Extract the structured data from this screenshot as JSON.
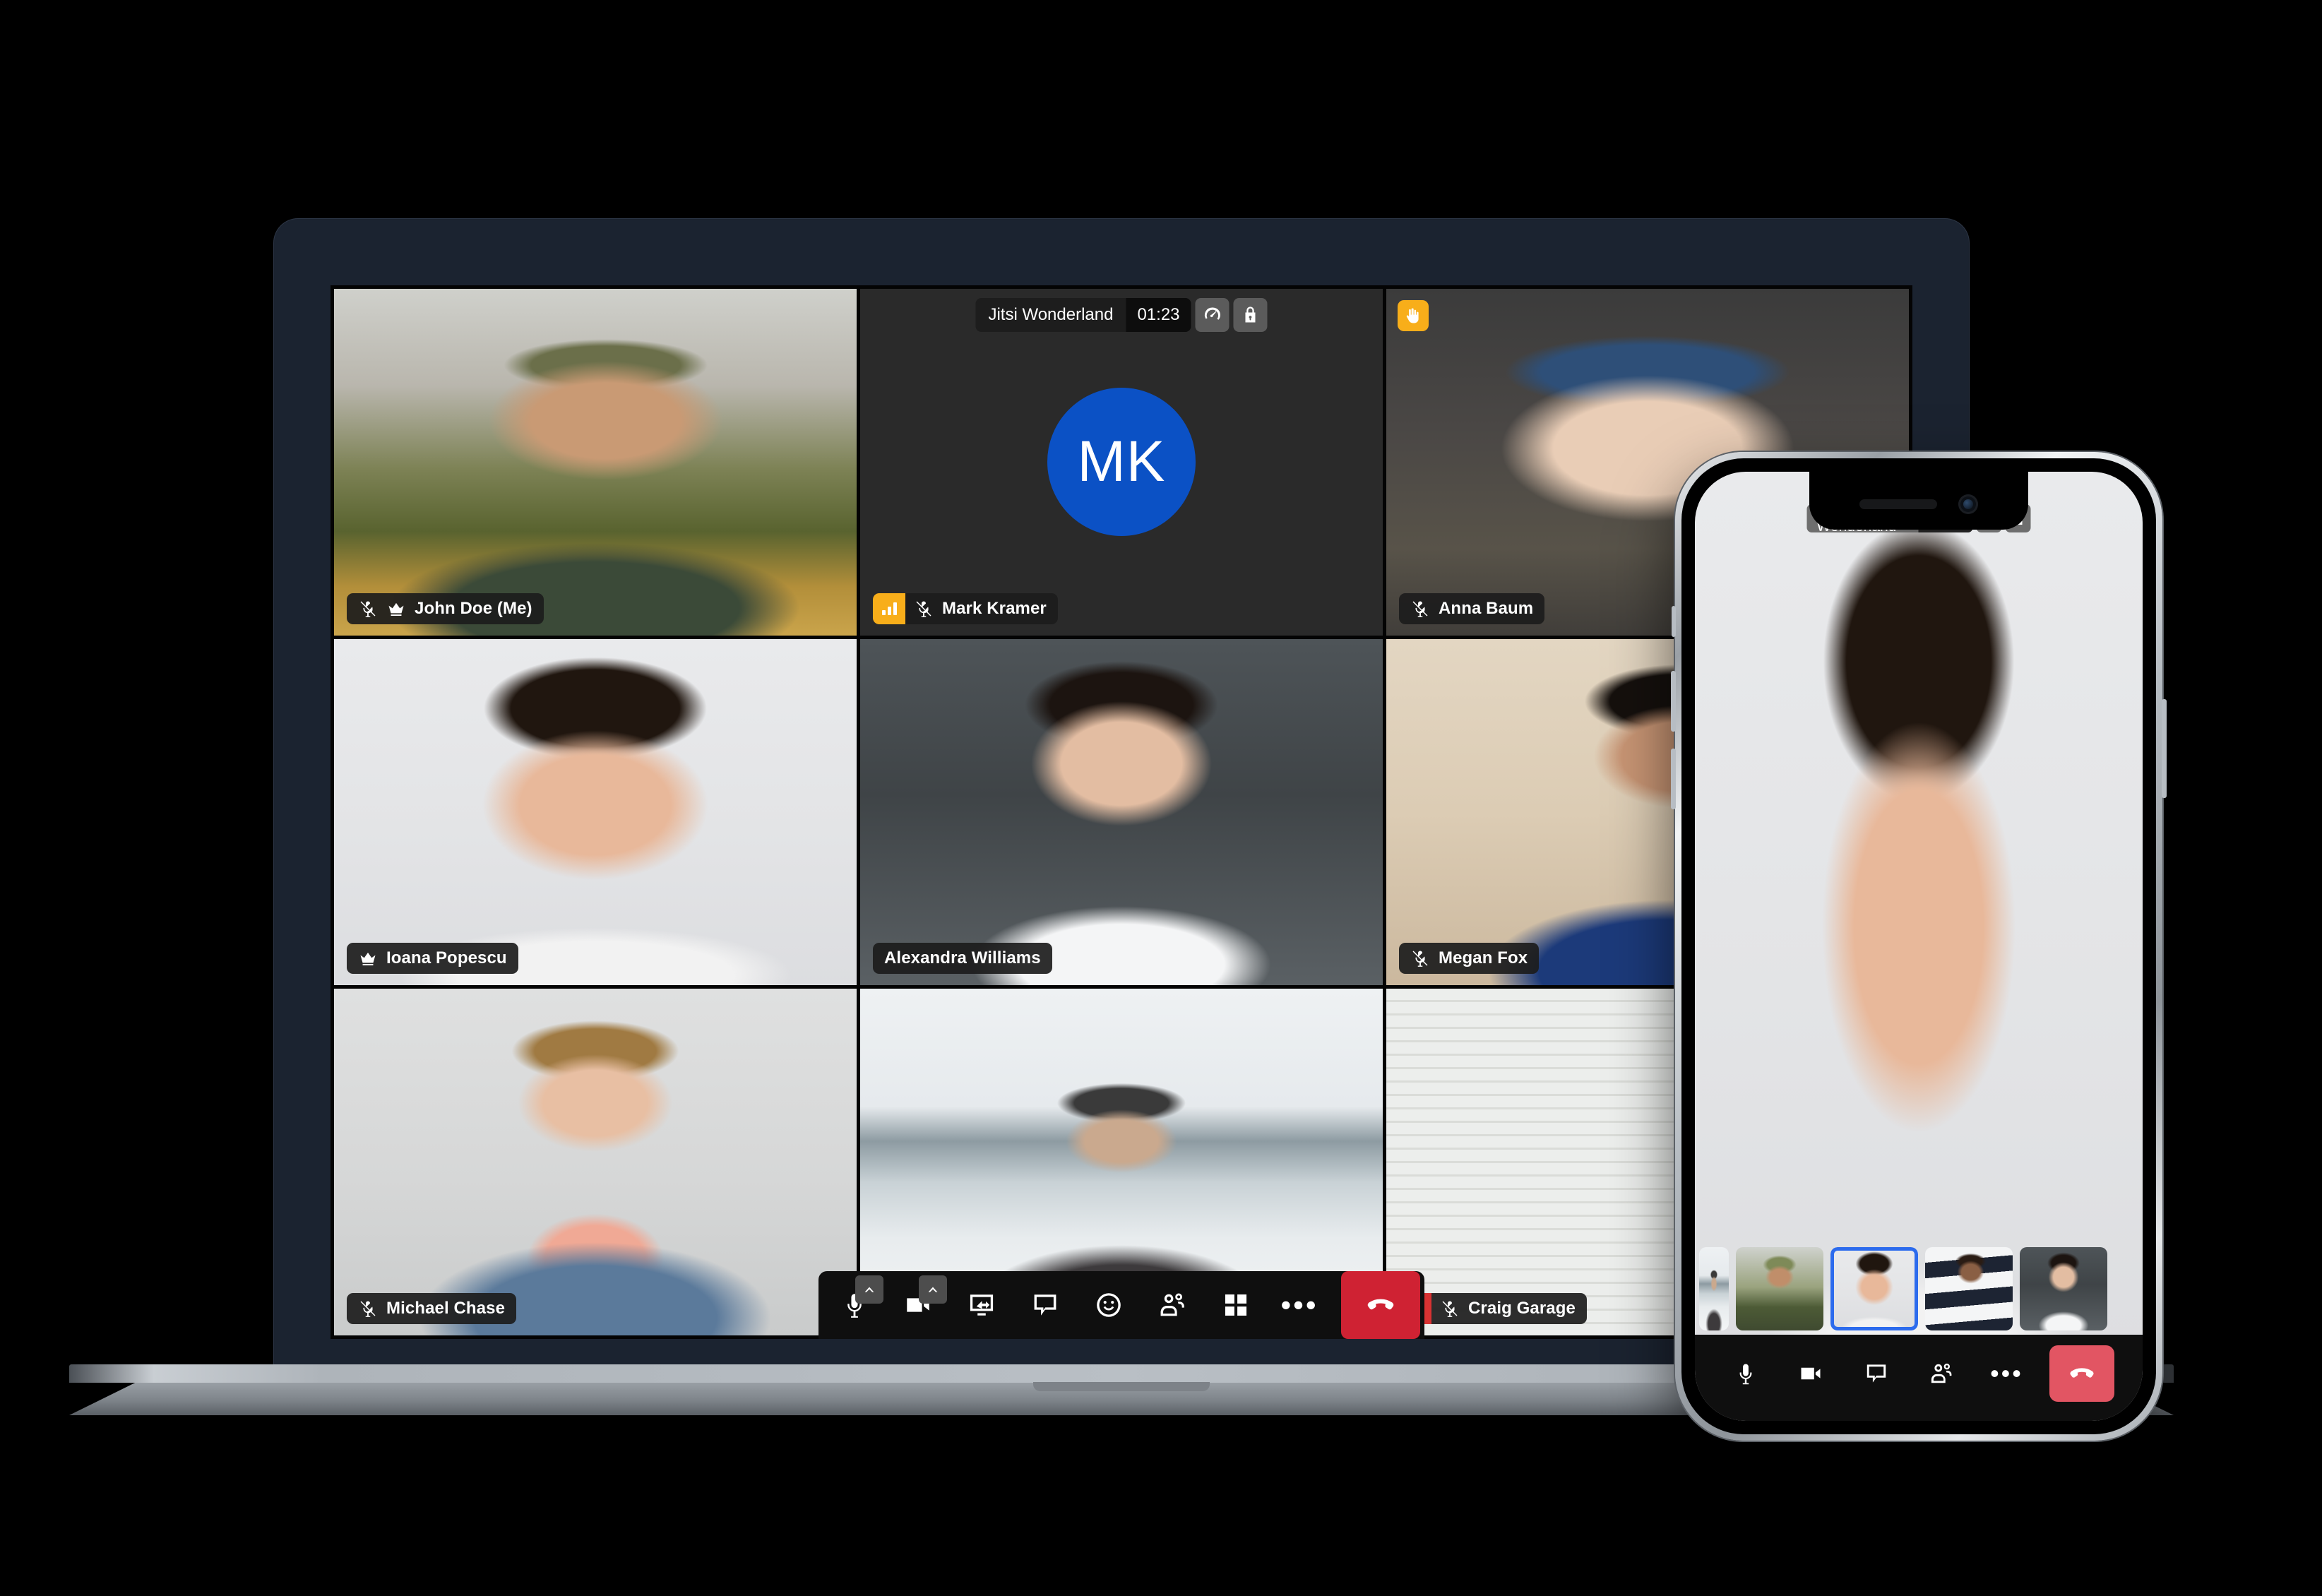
{
  "conference": {
    "name": "Jitsi Wonderland",
    "duration": "01:23",
    "quality_icon": "speedometer-icon",
    "security_icon": "lock-icon"
  },
  "laptop": {
    "tiles": [
      {
        "name": "John Doe (Me)",
        "photo": "p-john",
        "muted": true,
        "moderator": true,
        "connection": null,
        "hand": false,
        "active": false,
        "avatar": null
      },
      {
        "name": "Mark Kramer",
        "photo": null,
        "muted": true,
        "moderator": false,
        "connection": "good",
        "hand": false,
        "active": false,
        "avatar": "MK"
      },
      {
        "name": "Anna Baum",
        "photo": "p-anna",
        "muted": true,
        "moderator": false,
        "connection": null,
        "hand": true,
        "active": false,
        "avatar": null
      },
      {
        "name": "Ioana Popescu",
        "photo": "p-ioana",
        "muted": false,
        "moderator": true,
        "connection": null,
        "hand": false,
        "active": true,
        "avatar": null
      },
      {
        "name": "Alexandra Williams",
        "photo": "p-alex",
        "muted": false,
        "moderator": false,
        "connection": null,
        "hand": false,
        "active": false,
        "avatar": null
      },
      {
        "name": "Megan Fox",
        "photo": "p-megan",
        "muted": true,
        "moderator": false,
        "connection": null,
        "hand": false,
        "active": false,
        "avatar": null
      },
      {
        "name": "Michael Chase",
        "photo": "p-michael",
        "muted": true,
        "moderator": false,
        "connection": null,
        "hand": false,
        "active": false,
        "avatar": null
      },
      {
        "name": "",
        "photo": "p-lake",
        "muted": false,
        "moderator": false,
        "connection": null,
        "hand": false,
        "active": false,
        "avatar": null
      },
      {
        "name": "Craig Garage",
        "photo": "p-craig",
        "muted": true,
        "moderator": false,
        "connection": "bad",
        "hand": false,
        "active": false,
        "avatar": null
      }
    ],
    "toolbar": [
      {
        "label": "Mute / unmute microphone",
        "icon": "microphone-icon",
        "chevron": true,
        "type": "normal"
      },
      {
        "label": "Start / stop camera",
        "icon": "camera-icon",
        "chevron": true,
        "type": "normal"
      },
      {
        "label": "Share screen",
        "icon": "screen-share-icon",
        "chevron": false,
        "type": "normal"
      },
      {
        "label": "Open chat",
        "icon": "chat-icon",
        "chevron": false,
        "type": "normal"
      },
      {
        "label": "Reactions",
        "icon": "emoji-icon",
        "chevron": false,
        "type": "normal"
      },
      {
        "label": "Participants",
        "icon": "participants-icon",
        "chevron": false,
        "type": "normal"
      },
      {
        "label": "Toggle tile view",
        "icon": "tile-view-icon",
        "chevron": false,
        "type": "normal"
      },
      {
        "label": "More actions",
        "icon": "more-icon",
        "chevron": false,
        "type": "dots"
      },
      {
        "label": "Leave the meeting",
        "icon": "hangup-icon",
        "chevron": false,
        "type": "hangup"
      }
    ]
  },
  "phone": {
    "stage_photo": "p-ioana",
    "filmstrip": [
      {
        "photo": "p-lake",
        "selected": false,
        "edge": true
      },
      {
        "photo": "p-cam",
        "selected": false,
        "edge": false
      },
      {
        "photo": "p-ioana",
        "selected": true,
        "edge": false
      },
      {
        "photo": "p-stripe",
        "selected": false,
        "edge": false
      },
      {
        "photo": "p-alex",
        "selected": false,
        "edge": false
      }
    ],
    "toolbar": [
      {
        "label": "Mute / unmute microphone",
        "icon": "microphone-icon",
        "type": "normal"
      },
      {
        "label": "Start / stop camera",
        "icon": "camera-icon",
        "type": "normal"
      },
      {
        "label": "Open chat",
        "icon": "chat-icon",
        "type": "normal"
      },
      {
        "label": "Participants",
        "icon": "participants-icon",
        "type": "normal"
      },
      {
        "label": "More actions",
        "icon": "more-icon",
        "type": "dots"
      },
      {
        "label": "Leave the meeting",
        "icon": "hangup-icon",
        "type": "hangup"
      }
    ]
  },
  "colors": {
    "accent_blue": "#2c6bed",
    "avatar_blue": "#0b51c5",
    "warn_orange": "#f8ae1a",
    "danger_red": "#d83232",
    "hangup_red": "#cf2233",
    "phone_hangup_red": "#e25563"
  }
}
